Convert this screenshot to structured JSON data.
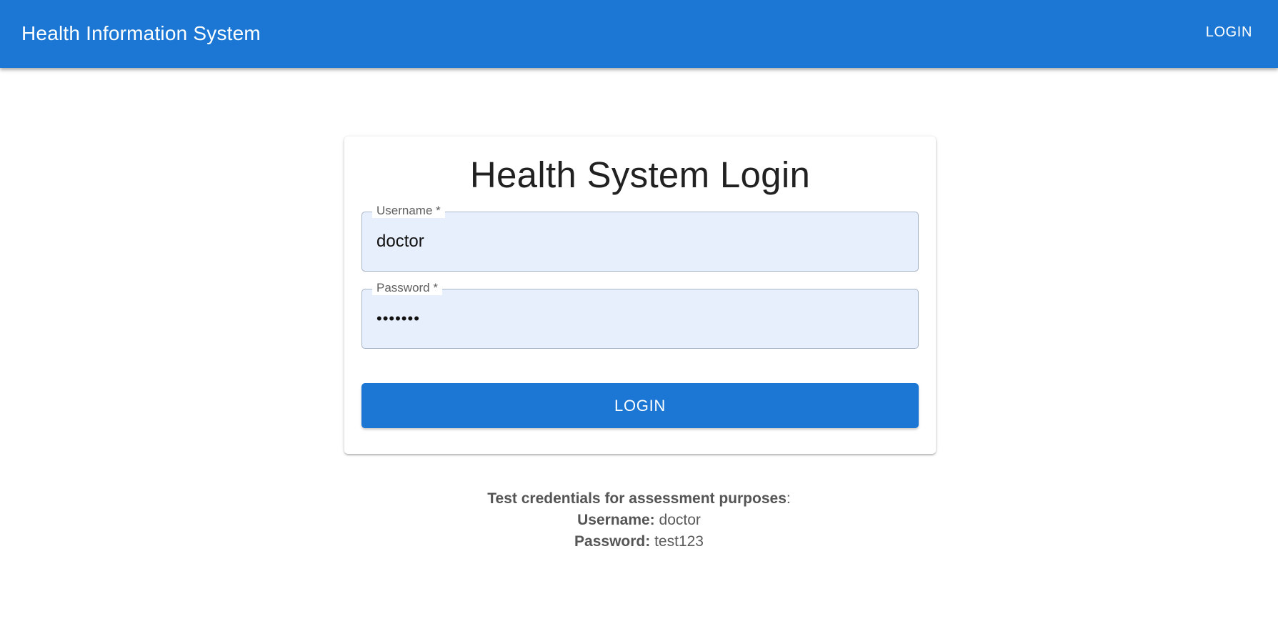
{
  "appbar": {
    "title": "Health Information System",
    "login_label": "LOGIN"
  },
  "login_card": {
    "title": "Health System Login",
    "username": {
      "label": "Username *",
      "value": "doctor"
    },
    "password": {
      "label": "Password *",
      "value": "•••••••"
    },
    "submit_label": "LOGIN"
  },
  "credentials": {
    "heading": "Test credentials for assessment purposes",
    "heading_suffix": ":",
    "username_label": "Username:",
    "username_value": "doctor",
    "password_label": "Password:",
    "password_value": "test123"
  },
  "colors": {
    "primary": "#1b77d3",
    "field_background": "#e8effc"
  }
}
